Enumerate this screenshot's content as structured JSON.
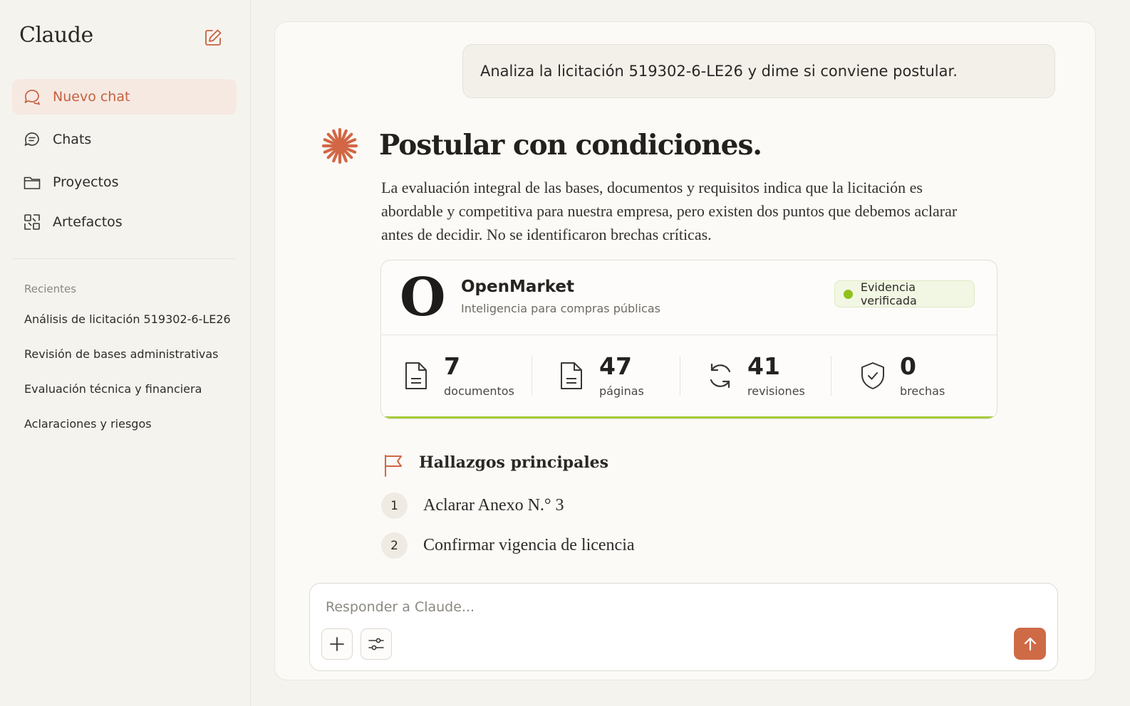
{
  "sidebar": {
    "brand": "Claude",
    "nav": [
      {
        "label": "Nuevo chat",
        "icon": "chat-bubble-icon",
        "active": true
      },
      {
        "label": "Chats",
        "icon": "chats-icon"
      },
      {
        "label": "Proyectos",
        "icon": "folder-icon"
      },
      {
        "label": "Artefactos",
        "icon": "artifacts-icon"
      }
    ],
    "recents_title": "Recientes",
    "recents": [
      "Análisis de licitación 519302-6-LE26",
      "Revisión de bases administrativas",
      "Evaluación técnica y financiera",
      "Aclaraciones y riesgos"
    ]
  },
  "conversation": {
    "user_message": "Analiza la licitación 519302-6-LE26 y dime si conviene postular.",
    "answer_title": "Postular con condiciones.",
    "answer_body": "La evaluación integral de las bases, documentos y requisitos indica que la licitación es abordable y competitiva para nuestra empresa, pero existen dos puntos que debemos aclarar antes de decidir. No se identificaron brechas críticas."
  },
  "card": {
    "logo_letter": "O",
    "name": "OpenMarket",
    "subtitle": "Inteligencia para compras públicas",
    "badge": "Evidencia verificada",
    "stats": [
      {
        "value": "7",
        "label": "documentos",
        "icon": "document-icon"
      },
      {
        "value": "47",
        "label": "páginas",
        "icon": "pages-icon"
      },
      {
        "value": "41",
        "label": "revisiones",
        "icon": "refresh-icon"
      },
      {
        "value": "0",
        "label": "brechas",
        "icon": "shield-check-icon"
      }
    ]
  },
  "findings": {
    "title": "Hallazgos principales",
    "items": [
      {
        "num": "1",
        "text": "Aclarar Anexo N.° 3"
      },
      {
        "num": "2",
        "text": "Confirmar vigencia de licencia"
      }
    ]
  },
  "composer": {
    "placeholder": "Responder a Claude..."
  },
  "colors": {
    "accent": "#cf6a47",
    "verified": "#8fc21c",
    "card_underline": "#a6cc3a"
  }
}
